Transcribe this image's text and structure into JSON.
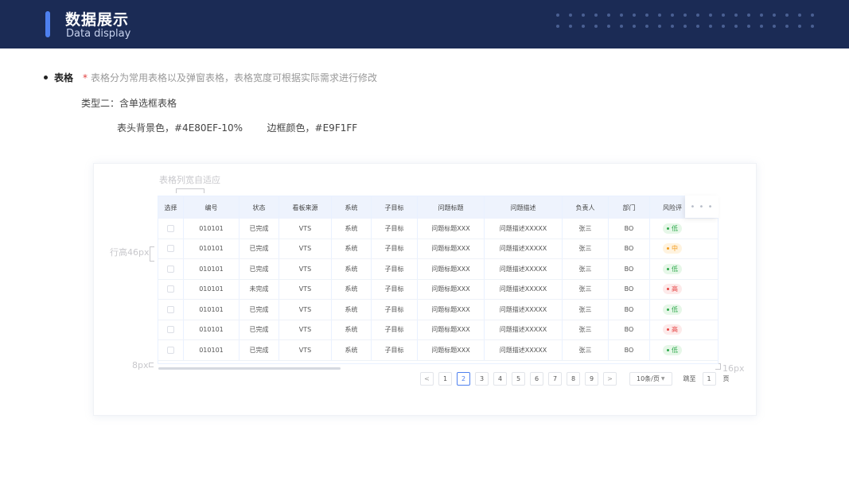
{
  "header": {
    "title": "数据展示",
    "subtitle": "Data display"
  },
  "section": {
    "title": "表格",
    "star": "*",
    "desc": "表格分为常用表格以及弹窗表格，表格宽度可根据实际需求进行修改",
    "type_line": "类型二：含单选框表格",
    "color_line": "表头背景色，#4E80EF-10%        边框颜色，#E9F1FF"
  },
  "annotations": {
    "col_adapt": "表格列宽自适应",
    "row_height": "行高46px",
    "left_gap": "8px",
    "right_gap": "16px"
  },
  "table": {
    "columns": [
      "选择",
      "编号",
      "状态",
      "看板来源",
      "系统",
      "子目标",
      "问题标题",
      "问题描述",
      "负责人",
      "部门",
      "风险评"
    ],
    "rows": [
      {
        "id": "010101",
        "status": "已完成",
        "source": "VTS",
        "system": "系统",
        "target": "子目标",
        "title": "问题标题XXX",
        "desc": "问题描述XXXXX",
        "owner": "张三",
        "dept": "BO",
        "risk": "低",
        "risk_level": "low"
      },
      {
        "id": "010101",
        "status": "已完成",
        "source": "VTS",
        "system": "系统",
        "target": "子目标",
        "title": "问题标题XXX",
        "desc": "问题描述XXXXX",
        "owner": "张三",
        "dept": "BO",
        "risk": "中",
        "risk_level": "mid"
      },
      {
        "id": "010101",
        "status": "已完成",
        "source": "VTS",
        "system": "系统",
        "target": "子目标",
        "title": "问题标题XXX",
        "desc": "问题描述XXXXX",
        "owner": "张三",
        "dept": "BO",
        "risk": "低",
        "risk_level": "low"
      },
      {
        "id": "010101",
        "status": "未完成",
        "source": "VTS",
        "system": "系统",
        "target": "子目标",
        "title": "问题标题XXX",
        "desc": "问题描述XXXXX",
        "owner": "张三",
        "dept": "BO",
        "risk": "高",
        "risk_level": "high"
      },
      {
        "id": "010101",
        "status": "已完成",
        "source": "VTS",
        "system": "系统",
        "target": "子目标",
        "title": "问题标题XXX",
        "desc": "问题描述XXXXX",
        "owner": "张三",
        "dept": "BO",
        "risk": "低",
        "risk_level": "low"
      },
      {
        "id": "010101",
        "status": "已完成",
        "source": "VTS",
        "system": "系统",
        "target": "子目标",
        "title": "问题标题XXX",
        "desc": "问题描述XXXXX",
        "owner": "张三",
        "dept": "BO",
        "risk": "高",
        "risk_level": "high"
      },
      {
        "id": "010101",
        "status": "已完成",
        "source": "VTS",
        "system": "系统",
        "target": "子目标",
        "title": "问题标题XXX",
        "desc": "问题描述XXXXX",
        "owner": "张三",
        "dept": "BO",
        "risk": "低",
        "risk_level": "low"
      }
    ],
    "more_icon": "more-horizontal-icon"
  },
  "pagination": {
    "prev": "<",
    "pages": [
      "1",
      "2",
      "3",
      "4",
      "5",
      "6",
      "7",
      "8",
      "9"
    ],
    "active_page": "2",
    "next": ">",
    "page_size": "10条/页",
    "jump_label": "跳至",
    "jump_value": "1",
    "unit": "页"
  },
  "colors": {
    "header_bg": "#1b2b55",
    "accent": "#4e80ef",
    "border": "#E9F1FF"
  }
}
